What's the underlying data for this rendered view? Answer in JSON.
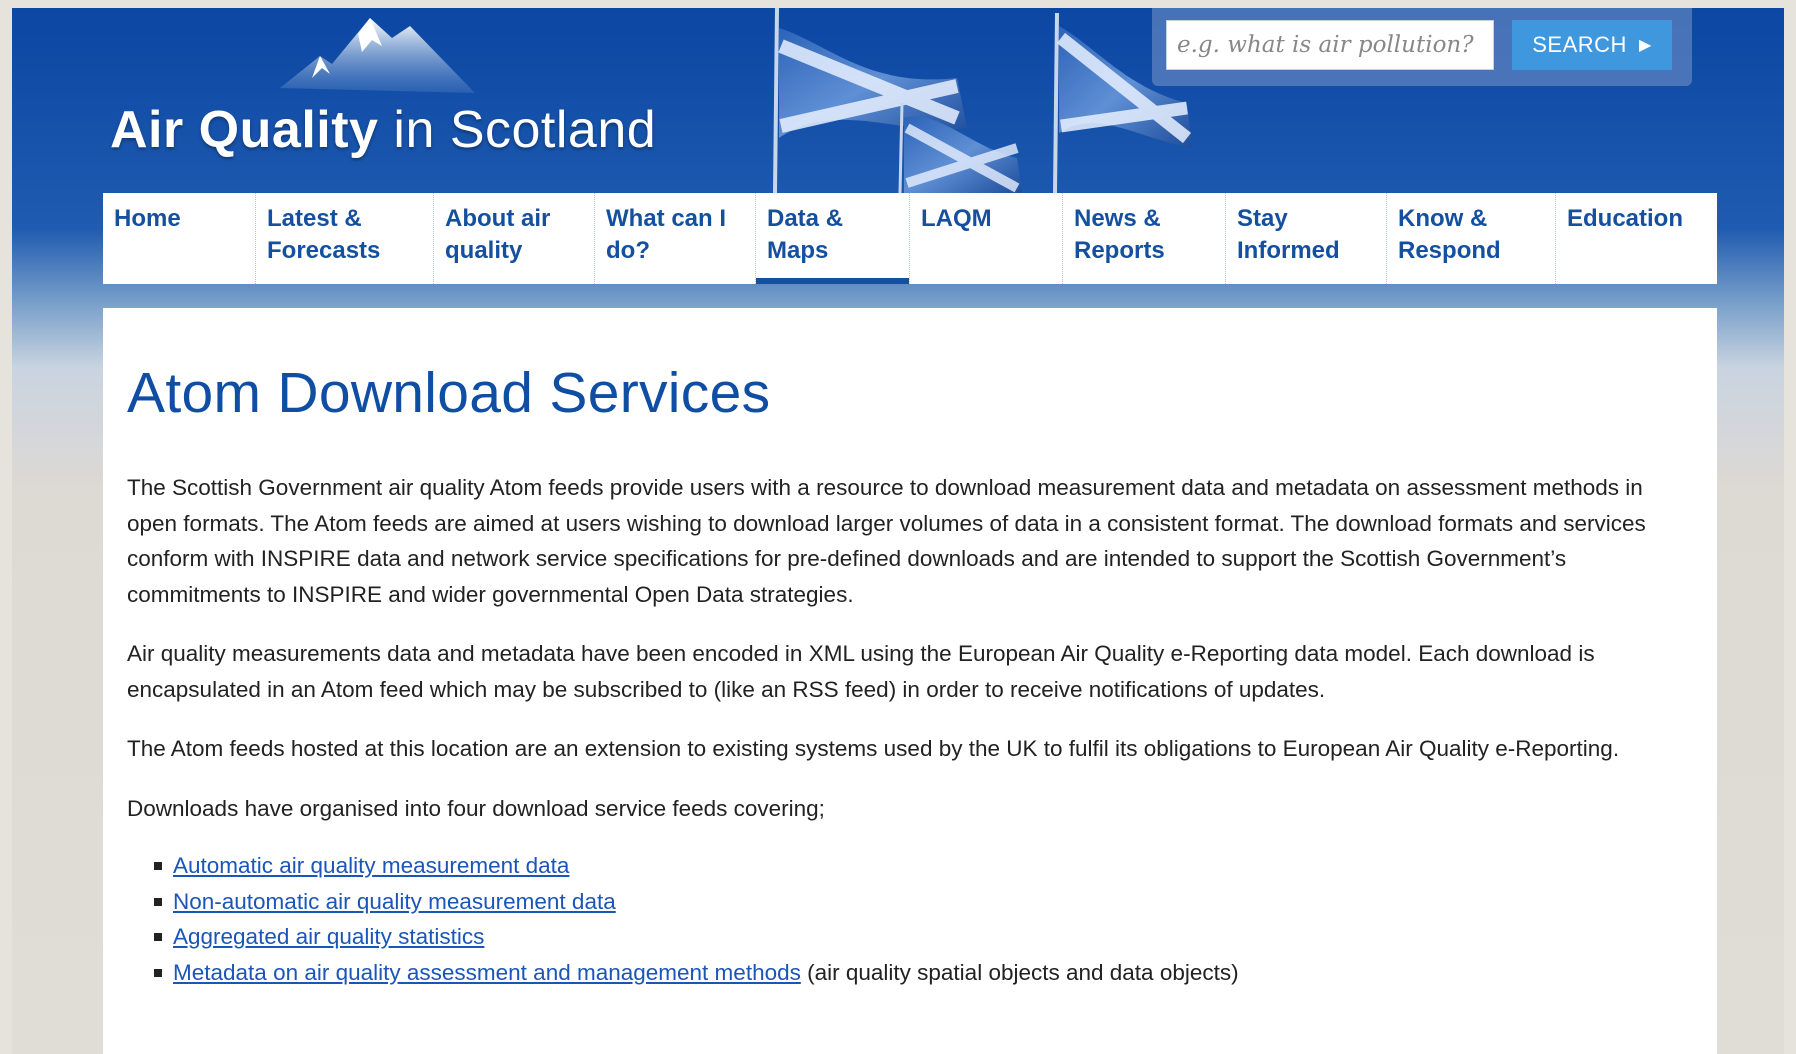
{
  "header": {
    "logo_bold": "Air Quality",
    "logo_rest": " in Scotland"
  },
  "search": {
    "placeholder": "e.g. what is air pollution?",
    "button_label": "SEARCH"
  },
  "nav": {
    "items": [
      {
        "label": "Home",
        "active": false
      },
      {
        "label": "Latest & Forecasts",
        "active": false
      },
      {
        "label": "About air quality",
        "active": false
      },
      {
        "label": "What can I do?",
        "active": false
      },
      {
        "label": "Data & Maps",
        "active": true
      },
      {
        "label": "LAQM",
        "active": false
      },
      {
        "label": "News & Reports",
        "active": false
      },
      {
        "label": "Stay Informed",
        "active": false
      },
      {
        "label": "Know & Respond",
        "active": false
      },
      {
        "label": "Education",
        "active": false
      }
    ]
  },
  "main": {
    "title": "Atom Download Services",
    "paragraphs": [
      "The Scottish Government air quality Atom feeds provide users with a resource to download measurement data and metadata on assessment methods in open formats. The Atom feeds are aimed at users wishing to download larger volumes of data in a consistent format. The download formats and services conform with INSPIRE data and network service specifications for pre-defined downloads and are intended to support the Scottish Government’s commitments to INSPIRE and wider governmental Open Data strategies.",
      "Air quality measurements data and metadata have been encoded in XML using the European Air Quality e-Reporting data model. Each download is encapsulated in an Atom feed which may be subscribed to (like an RSS feed) in order to receive notifications of updates.",
      "The Atom feeds hosted at this location are an extension to existing systems used by the UK to fulfil its obligations to European Air Quality e-Reporting.",
      "Downloads have organised into four download service feeds covering;"
    ],
    "feeds": [
      {
        "link": "Automatic air quality measurement data",
        "suffix": ""
      },
      {
        "link": "Non-automatic air quality measurement data",
        "suffix": ""
      },
      {
        "link": "Aggregated air quality statistics",
        "suffix": ""
      },
      {
        "link": "Metadata on air quality assessment and management methods",
        "suffix": " (air quality spatial objects and data objects)"
      }
    ]
  },
  "colors": {
    "brand_blue": "#0f4ea3",
    "nav_text": "#15509f",
    "link": "#1a56b8",
    "search_button": "#3f97dd"
  },
  "icons": {
    "logo": "mountain-logo-icon",
    "search_chevron": "chevron-right-icon",
    "flags": "saltire-flag-icon",
    "bullet": "square-bullet-icon"
  }
}
